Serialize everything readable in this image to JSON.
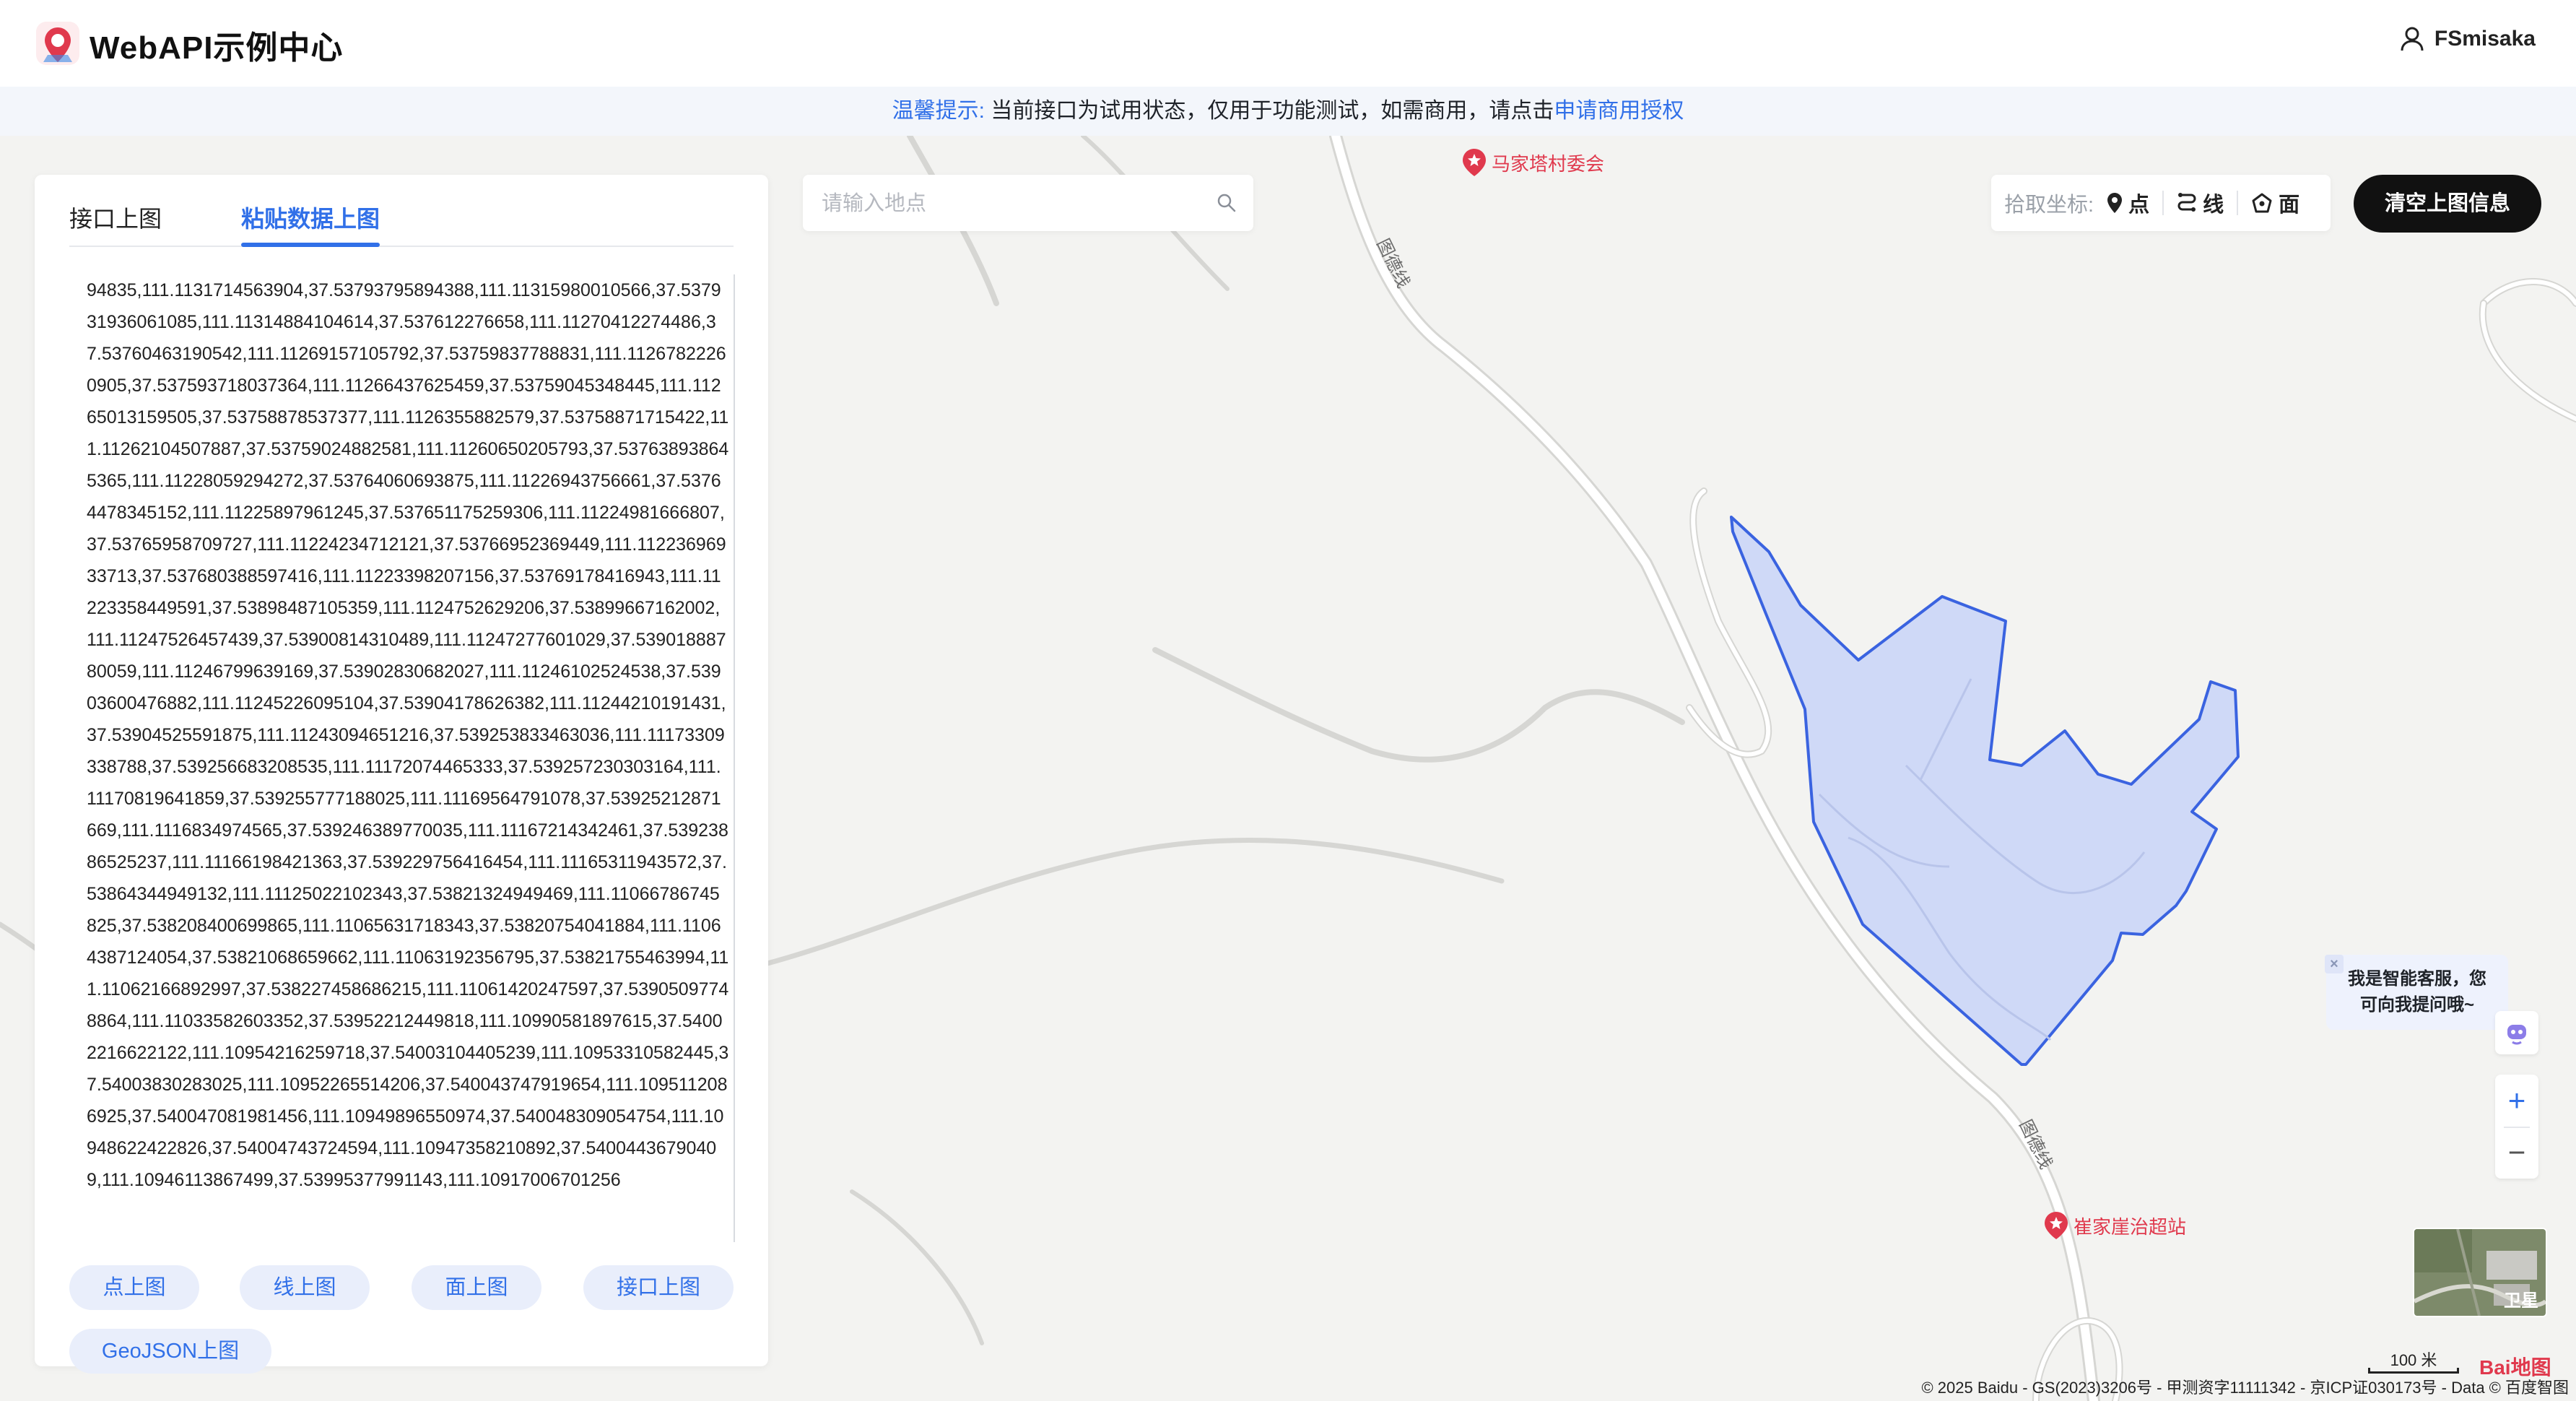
{
  "header": {
    "app_title": "WebAPI示例中心",
    "user_name": "FSmisaka"
  },
  "notice": {
    "label": "温馨提示:",
    "text": "当前接口为试用状态，仅用于功能测试，如需商用，请点击",
    "link": "申请商用授权"
  },
  "panel": {
    "tabs": [
      {
        "label": "接口上图",
        "active": false
      },
      {
        "label": "粘贴数据上图",
        "active": true
      }
    ],
    "textarea_value": "94835,111.1131714563904,37.53793795894388,111.11315980010566,37.537931936061085,111.11314884104614,37.537612276658,111.11270412274486,37.53760463190542,111.11269157105792,37.53759837788831,111.11267822260905,37.537593718037364,111.11266437625459,37.53759045348445,111.11265013159505,37.53758878537377,111.1126355882579,37.53758871715422,111.11262104507887,37.53759024882581,111.11260650205793,37.537638938645365,111.11228059294272,37.53764060693875,111.11226943756661,37.53764478345152,111.11225897961245,37.537651175259306,111.11224981666807,37.53765958709727,111.11224234712121,37.53766952369449,111.11223696933713,37.537680388597416,111.11223398207156,37.53769178416943,111.11223358449591,37.53898487105359,111.1124752629206,37.53899667162002,111.11247526457439,37.53900814310489,111.11247277601029,37.53901888780059,111.11246799639169,37.53902830682027,111.11246102524538,37.53903600476882,111.11245226095104,37.53904178626382,111.11244210191431,37.53904525591875,111.11243094651216,37.539253833463036,111.11173309338788,37.539256683208535,111.11172074465333,37.539257230303164,111.11170819641859,37.539255777188025,111.11169564791078,37.53925212871669,111.1116834974565,37.539246389770035,111.11167214342461,37.53923886525237,111.11166198421363,37.539229756416454,111.11165311943572,37.53864344949132,111.11125022102343,37.53821324949469,111.11066786745825,37.538208400699865,111.11065631718343,37.53820754041884,111.11064387124054,37.53821068659662,111.11063192356795,37.53821755463994,111.11062166892997,37.538227458686215,111.11061420247597,37.53905097748864,111.11033582603352,37.53952212449818,111.10990581897615,37.54002216622122,111.10954216259718,37.54003104405239,111.10953310582445,37.54003830283025,111.10952265514206,37.540043747919654,111.1095112086925,37.540047081981456,111.10949896550974,37.540048309054754,111.10948622422826,37.54004743724594,111.10947358210892,37.54004436790409,111.10946113867499,37.53995377991143,111.10917006701256",
    "buttons": [
      "点上图",
      "线上图",
      "面上图",
      "接口上图",
      "GeoJSON上图"
    ]
  },
  "search": {
    "placeholder": "请输入地点"
  },
  "picker": {
    "label": "拾取坐标:",
    "items": [
      {
        "icon": "map-pin-icon",
        "label": "点"
      },
      {
        "icon": "route-icon",
        "label": "线"
      },
      {
        "icon": "polygon-icon",
        "label": "面"
      }
    ]
  },
  "clear_button": "清空上图信息",
  "map": {
    "pois": [
      "马家塔村委会",
      "崔家崖治超站"
    ],
    "road_labels": [
      "图德线",
      "图德线"
    ],
    "polygon_color": "#3a63e0",
    "polygon_fill": "#cfd9f7"
  },
  "assistant": {
    "line1": "我是智能客服，您",
    "line2": "可向我提问哦~",
    "close": "×"
  },
  "zoom": {
    "in": "+",
    "out": "−"
  },
  "satellite_label": "卫星",
  "scale_label": "100 米",
  "baidu_logo": "Bai地图",
  "copyright": "© 2025 Baidu - GS(2023)3206号 - 甲测资字11111342 - 京ICP证030173号 - Data © 百度智图"
}
